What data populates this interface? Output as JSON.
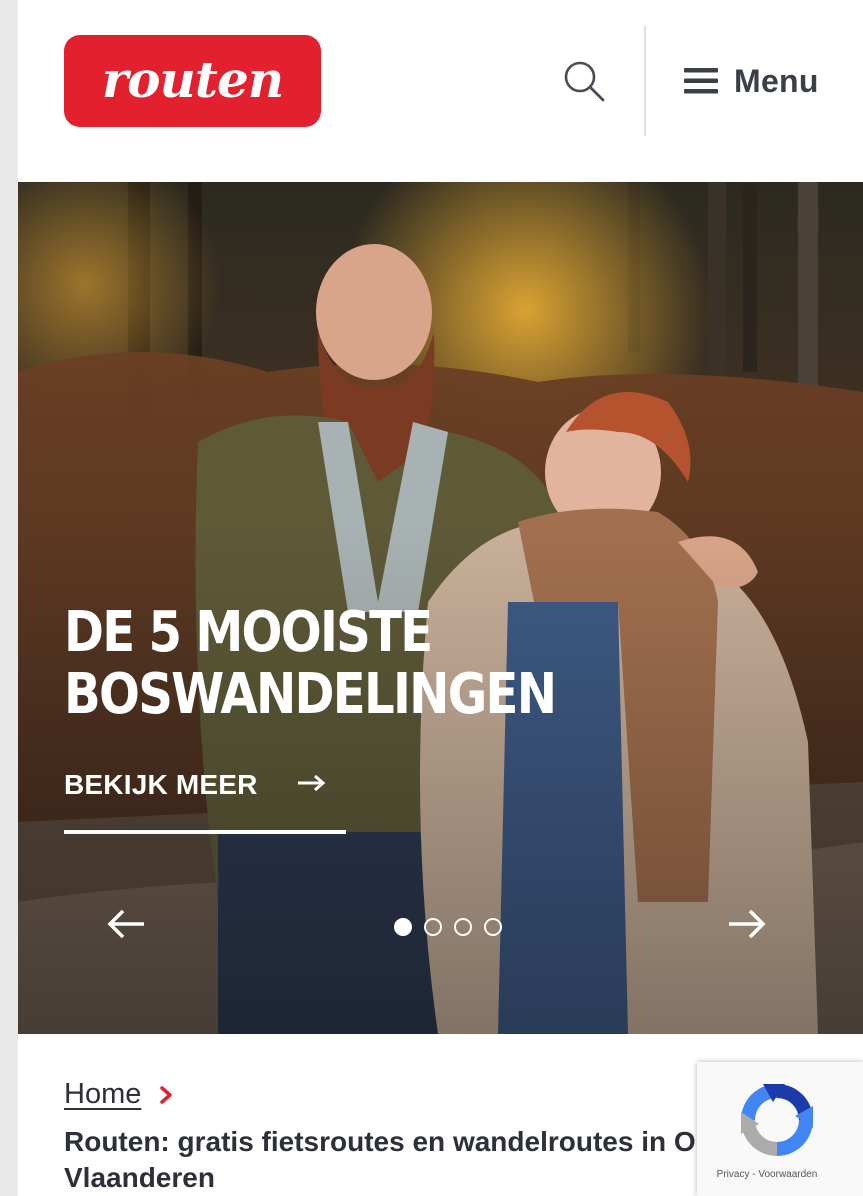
{
  "header": {
    "logo_text": "routen",
    "search_icon": "search-icon",
    "menu_icon": "hamburger-icon",
    "menu_label": "Menu"
  },
  "hero": {
    "title_line1": "DE 5 MOOISTE",
    "title_line2": "BOSWANDELINGEN",
    "cta_label": "BEKIJK MEER",
    "cta_icon": "arrow-right-icon",
    "prev_icon": "arrow-left-icon",
    "next_icon": "arrow-right-icon",
    "slides_total": 4,
    "slide_active": 1
  },
  "breadcrumb": {
    "home_label": "Home",
    "separator_icon": "chevron-right-icon"
  },
  "page_heading": {
    "line1": "Routen: gratis fietsroutes en wandelroutes in O",
    "line2": "Vlaanderen"
  },
  "recaptcha": {
    "privacy_label": "Privacy",
    "separator": "-",
    "terms_label": "Voorwaarden"
  },
  "colors": {
    "brand_red": "#e3202e",
    "text_dark": "#2d3038",
    "menu_text": "#3b3f47"
  }
}
